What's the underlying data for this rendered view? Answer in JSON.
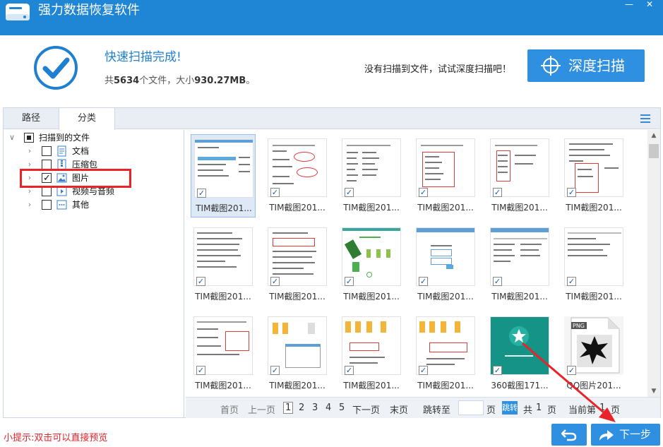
{
  "window": {
    "title": "强力数据恢复软件",
    "minimize_glyph": "—",
    "close_glyph": "✕"
  },
  "status": {
    "title": "快速扫描完成!",
    "summary_prefix": "共",
    "file_count": "5634",
    "summary_mid": "个文件，大小",
    "total_size": "930.27MB",
    "summary_suffix": "。",
    "deep_hint": "没有扫描到文件，试试深度扫描吧！",
    "deep_button": "深度扫描"
  },
  "tabs": [
    {
      "label": "路径",
      "active": false
    },
    {
      "label": "分类",
      "active": true
    }
  ],
  "tree": {
    "root": {
      "label": "扫描到的文件",
      "state": "partial"
    },
    "items": [
      {
        "label": "文档",
        "icon": "document-icon",
        "checked": false
      },
      {
        "label": "压缩包",
        "icon": "archive-icon",
        "checked": false
      },
      {
        "label": "图片",
        "icon": "image-icon",
        "checked": true
      },
      {
        "label": "视频与音频",
        "icon": "video-icon",
        "checked": false
      },
      {
        "label": "其他",
        "icon": "other-icon",
        "checked": false
      }
    ]
  },
  "files": [
    {
      "label": "TIM截图201...",
      "checked": true,
      "selected": true
    },
    {
      "label": "TIM截图201...",
      "checked": true
    },
    {
      "label": "TIM截图201...",
      "checked": true
    },
    {
      "label": "TIM截图201...",
      "checked": true
    },
    {
      "label": "TIM截图201...",
      "checked": true
    },
    {
      "label": "TIM截图201...",
      "checked": true
    },
    {
      "label": "TIM截图201...",
      "checked": true
    },
    {
      "label": "TIM截图201...",
      "checked": true
    },
    {
      "label": "TIM截图201...",
      "checked": true
    },
    {
      "label": "TIM截图201...",
      "checked": true
    },
    {
      "label": "TIM截图201...",
      "checked": true
    },
    {
      "label": "TIM截图201...",
      "checked": true
    },
    {
      "label": "TIM截图201...",
      "checked": true
    },
    {
      "label": "TIM截图201...",
      "checked": true
    },
    {
      "label": "TIM截图201...",
      "checked": true
    },
    {
      "label": "TIM截图201...",
      "checked": true
    },
    {
      "label": "360截图171...",
      "checked": true
    },
    {
      "label": "QQ图片201...",
      "checked": true,
      "png_badge": "PNG"
    }
  ],
  "pager": {
    "first": "首页",
    "prev": "上一页",
    "pages": [
      "1",
      "2",
      "3",
      "4",
      "5"
    ],
    "current": "1",
    "next": "下一页",
    "last": "末页",
    "jump_to": "跳转至",
    "page_unit": "页",
    "go": "跳转",
    "total_prefix": "共",
    "total_pages": "1",
    "current_label": "当前第",
    "current_suffix": "页"
  },
  "footer": {
    "tip": "小提示:双击可以直接预览",
    "next_button": "下一步"
  },
  "colors": {
    "brand_blue": "#1f86d6",
    "button_blue": "#2f8fe1",
    "annotation_red": "#e8232a"
  }
}
